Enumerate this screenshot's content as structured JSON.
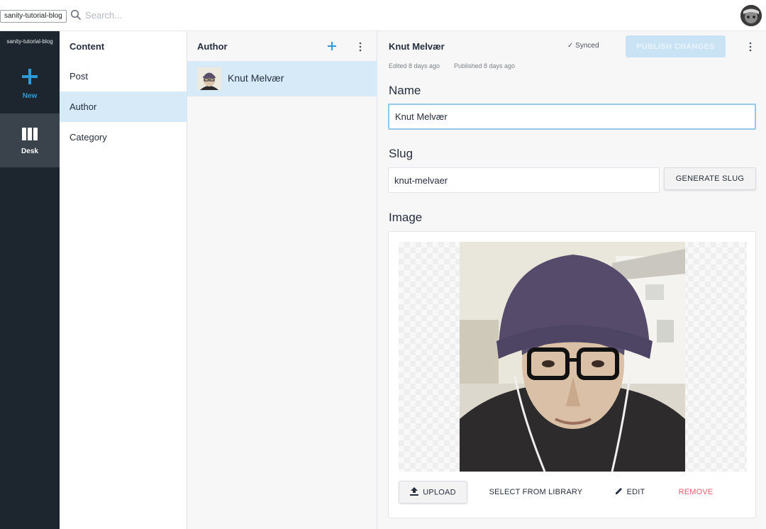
{
  "topbar": {
    "tooltip": "sanity-tutorial-blog",
    "search_placeholder": "Search..."
  },
  "leftnav": {
    "project_name": "sanity-tutorial-blog",
    "new_label": "New",
    "desk_label": "Desk"
  },
  "content_pane": {
    "title": "Content",
    "items": [
      "Post",
      "Author",
      "Category"
    ],
    "active_index": 1
  },
  "author_pane": {
    "title": "Author",
    "items": [
      {
        "name": "Knut Melvær"
      }
    ]
  },
  "editor": {
    "doc_title": "Knut Melvær",
    "edited": "Edited 8 days ago",
    "published": "Published 8 days ago",
    "synced": "✓ Synced",
    "publish_label": "PUBLISH CHANGES",
    "name_label": "Name",
    "name_value": "Knut Melvær",
    "slug_label": "Slug",
    "slug_value": "knut-melvaer",
    "generate_slug_label": "GENERATE SLUG",
    "image_label": "Image",
    "upload_label": "UPLOAD",
    "select_library_label": "SELECT FROM LIBRARY",
    "edit_label": "EDIT",
    "remove_label": "REMOVE"
  },
  "colors": {
    "sidebar_bg": "#1d262f",
    "accent": "#2d9bd8",
    "selected_row": "#d6eaf7",
    "publish_disabled": "#c9e3f5",
    "remove": "#e0606e"
  },
  "icons": [
    "search-icon",
    "plus-icon",
    "desk-icon",
    "add-icon",
    "more-vertical-icon",
    "upload-icon",
    "edit-pencil-icon"
  ]
}
